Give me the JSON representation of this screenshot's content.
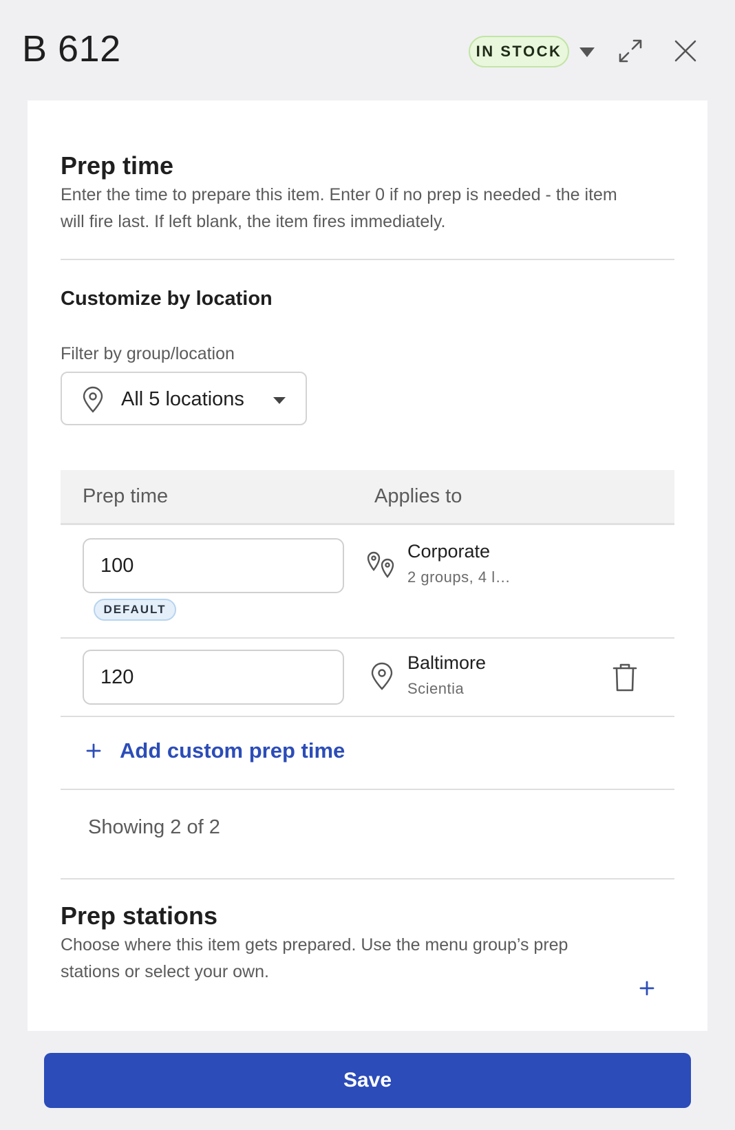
{
  "header": {
    "title": "B 612",
    "stock_status": "IN STOCK"
  },
  "prep_time": {
    "title": "Prep time",
    "description": "Enter the time to prepare this item. Enter 0 if no prep is needed - the item will fire last. If left blank, the item fires immediately.",
    "customize_heading": "Customize by location",
    "filter_label": "Filter by group/location",
    "filter_value": "All 5 locations",
    "table": {
      "columns": [
        "Prep time",
        "Applies to"
      ],
      "rows": [
        {
          "value": "100",
          "badge": "DEFAULT",
          "location": "Corporate",
          "detail": "2 groups, 4 l…",
          "icon": "multi-location-pin-icon"
        },
        {
          "value": "120",
          "badge": "",
          "location": "Baltimore",
          "detail": "Scientia",
          "icon": "location-pin-icon"
        }
      ]
    },
    "add_label": "Add custom prep time",
    "showing": "Showing 2 of 2"
  },
  "prep_stations": {
    "title": "Prep stations",
    "description": "Choose where this item gets prepared. Use the menu group’s prep stations or select your own."
  },
  "footer": {
    "save_label": "Save"
  },
  "colors": {
    "accent": "#2b4cb9",
    "stock_bg": "#e9f7dd",
    "default_badge_bg": "#e4effa",
    "page_bg": "#f0f0f3"
  }
}
